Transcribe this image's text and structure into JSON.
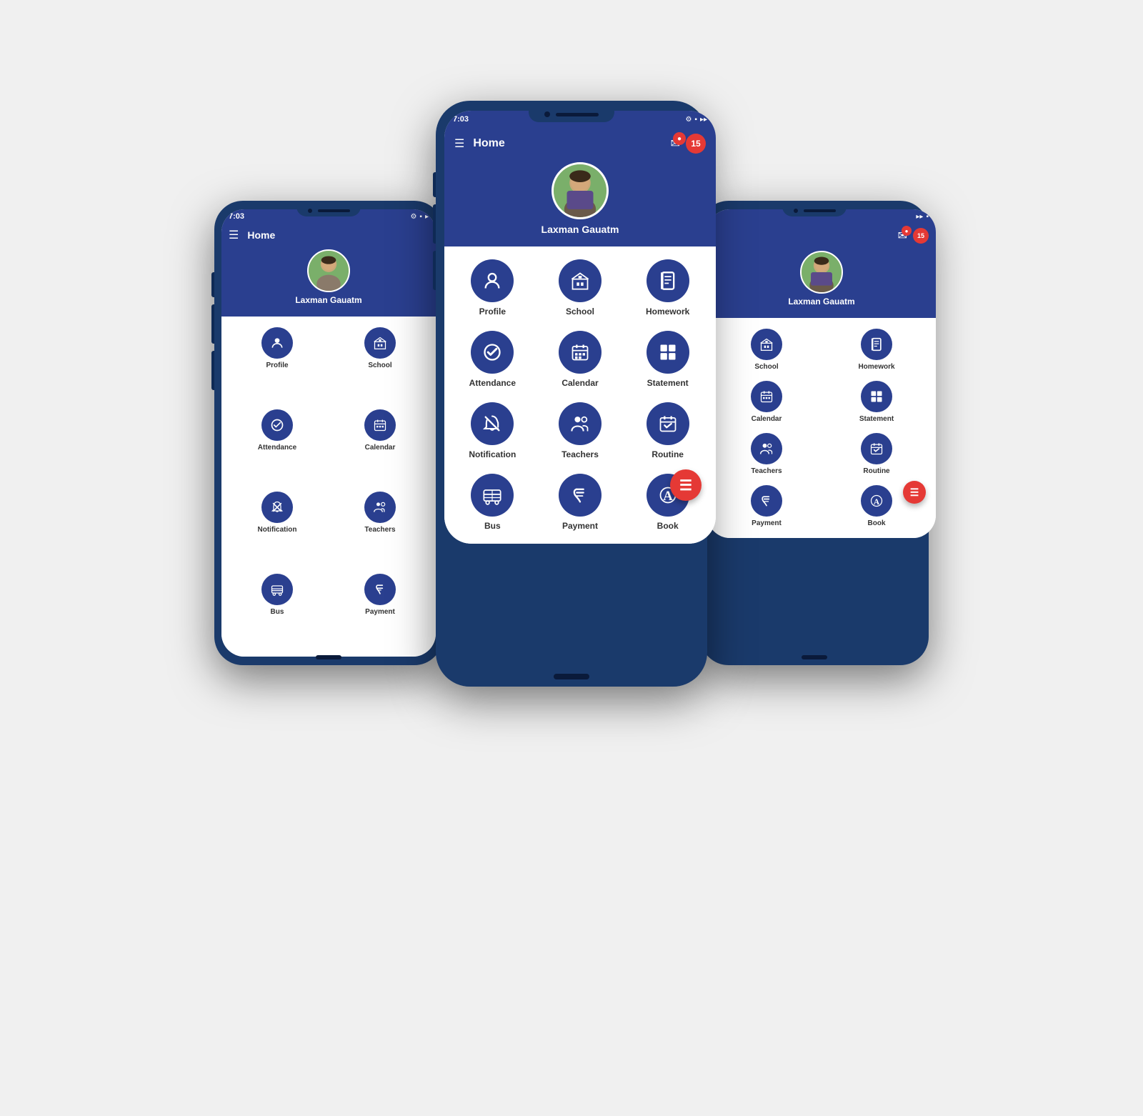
{
  "app": {
    "title": "Home",
    "user_name": "Laxman Gauatm",
    "notification_count": "15",
    "status_time": "7:03"
  },
  "menu_items": [
    {
      "id": "profile",
      "label": "Profile",
      "icon": "person"
    },
    {
      "id": "school",
      "label": "School",
      "icon": "building"
    },
    {
      "id": "homework",
      "label": "Homework",
      "icon": "book"
    },
    {
      "id": "attendance",
      "label": "Attendance",
      "icon": "check"
    },
    {
      "id": "calendar",
      "label": "Calendar",
      "icon": "calendar"
    },
    {
      "id": "statement",
      "label": "Statement",
      "icon": "grid"
    },
    {
      "id": "notification",
      "label": "Notification",
      "icon": "bell-slash"
    },
    {
      "id": "teachers",
      "label": "Teachers",
      "icon": "people"
    },
    {
      "id": "routine",
      "label": "Routine",
      "icon": "cal-check"
    },
    {
      "id": "bus",
      "label": "Bus",
      "icon": "bus"
    },
    {
      "id": "payment",
      "label": "Payment",
      "icon": "rupee"
    },
    {
      "id": "book2",
      "label": "Book",
      "icon": "book2"
    }
  ],
  "side_menu_items": [
    {
      "id": "profile",
      "label": "Profile",
      "icon": "person"
    },
    {
      "id": "school",
      "label": "School",
      "icon": "building"
    },
    {
      "id": "attendance",
      "label": "Attendance",
      "icon": "check"
    },
    {
      "id": "calendar",
      "label": "Calendar",
      "icon": "calendar"
    },
    {
      "id": "notification",
      "label": "Notification",
      "icon": "bell-slash"
    },
    {
      "id": "teachers",
      "label": "Teachers",
      "icon": "people"
    },
    {
      "id": "bus",
      "label": "Bus",
      "icon": "bus"
    },
    {
      "id": "payment",
      "label": "Payment",
      "icon": "rupee"
    }
  ],
  "right_menu_items": [
    {
      "id": "school",
      "label": "School",
      "icon": "building"
    },
    {
      "id": "homework",
      "label": "Homework",
      "icon": "book"
    },
    {
      "id": "calendar",
      "label": "Calendar",
      "icon": "calendar"
    },
    {
      "id": "statement",
      "label": "Statement",
      "icon": "grid"
    },
    {
      "id": "teachers",
      "label": "Teachers",
      "icon": "people"
    },
    {
      "id": "routine",
      "label": "Routine",
      "icon": "cal-check"
    },
    {
      "id": "payment",
      "label": "Payment",
      "icon": "rupee"
    },
    {
      "id": "book2",
      "label": "Book",
      "icon": "book2"
    }
  ]
}
